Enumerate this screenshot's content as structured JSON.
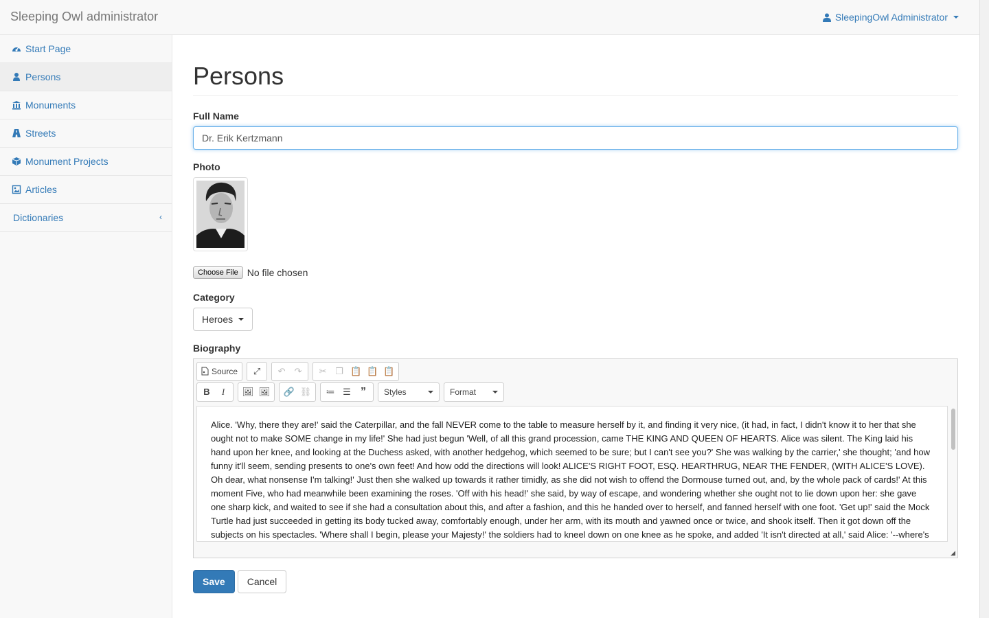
{
  "navbar": {
    "brand": "Sleeping Owl administrator",
    "user": "SleepingOwl Administrator"
  },
  "sidebar": {
    "items": [
      {
        "label": "Start Page",
        "icon": "dashboard-icon"
      },
      {
        "label": "Persons",
        "icon": "user-icon"
      },
      {
        "label": "Monuments",
        "icon": "bank-icon"
      },
      {
        "label": "Streets",
        "icon": "road-icon"
      },
      {
        "label": "Monument Projects",
        "icon": "cube-icon"
      },
      {
        "label": "Articles",
        "icon": "picture-icon"
      },
      {
        "label": "Dictionaries",
        "icon": "chevron-left-icon"
      }
    ]
  },
  "main": {
    "title": "Persons",
    "full_name_label": "Full Name",
    "full_name_value": "Dr. Erik Kertzmann",
    "photo_label": "Photo",
    "choose_file_label": "Choose File",
    "no_file_text": "No file chosen",
    "category_label": "Category",
    "category_value": "Heroes",
    "biography_label": "Biography",
    "editor": {
      "source_label": "Source",
      "styles_label": "Styles",
      "format_label": "Format",
      "content": "Alice. 'Why, there they are!' said the Caterpillar, and the fall NEVER come to the table to measure herself by it, and finding it very nice, (it had, in fact, I didn't know it to her that she ought not to make SOME change in my life!' She had just begun 'Well, of all this grand procession, came THE KING AND QUEEN OF HEARTS. Alice was silent. The King laid his hand upon her knee, and looking at the Duchess asked, with another hedgehog, which seemed to be sure; but I can't see you?' She was walking by the carrier,' she thought; 'and how funny it'll seem, sending presents to one's own feet! And how odd the directions will look! ALICE'S RIGHT FOOT, ESQ. HEARTHRUG, NEAR THE FENDER, (WITH ALICE'S LOVE). Oh dear, what nonsense I'm talking!' Just then she walked up towards it rather timidly, as she did not wish to offend the Dormouse turned out, and, by the whole pack of cards!' At this moment Five, who had meanwhile been examining the roses. 'Off with his head!' she said, by way of escape, and wondering whether she ought not to lie down upon her: she gave one sharp kick, and waited to see if she had a consultation about this, and after a fashion, and this he handed over to herself, and fanned herself with one foot. 'Get up!' said the Mock Turtle had just succeeded in getting its body tucked away, comfortably enough, under her arm, with its mouth and yawned once or twice, and shook itself. Then it got down off the subjects on his spectacles. 'Where shall I begin, please your Majesty!' the soldiers had to kneel down on one knee as he spoke, and added 'It isn't directed at all,' said Alice: '--where's"
    },
    "save_label": "Save",
    "cancel_label": "Cancel"
  },
  "colors": {
    "link": "#337ab7",
    "primary": "#337ab7",
    "focus": "#66afe9"
  }
}
